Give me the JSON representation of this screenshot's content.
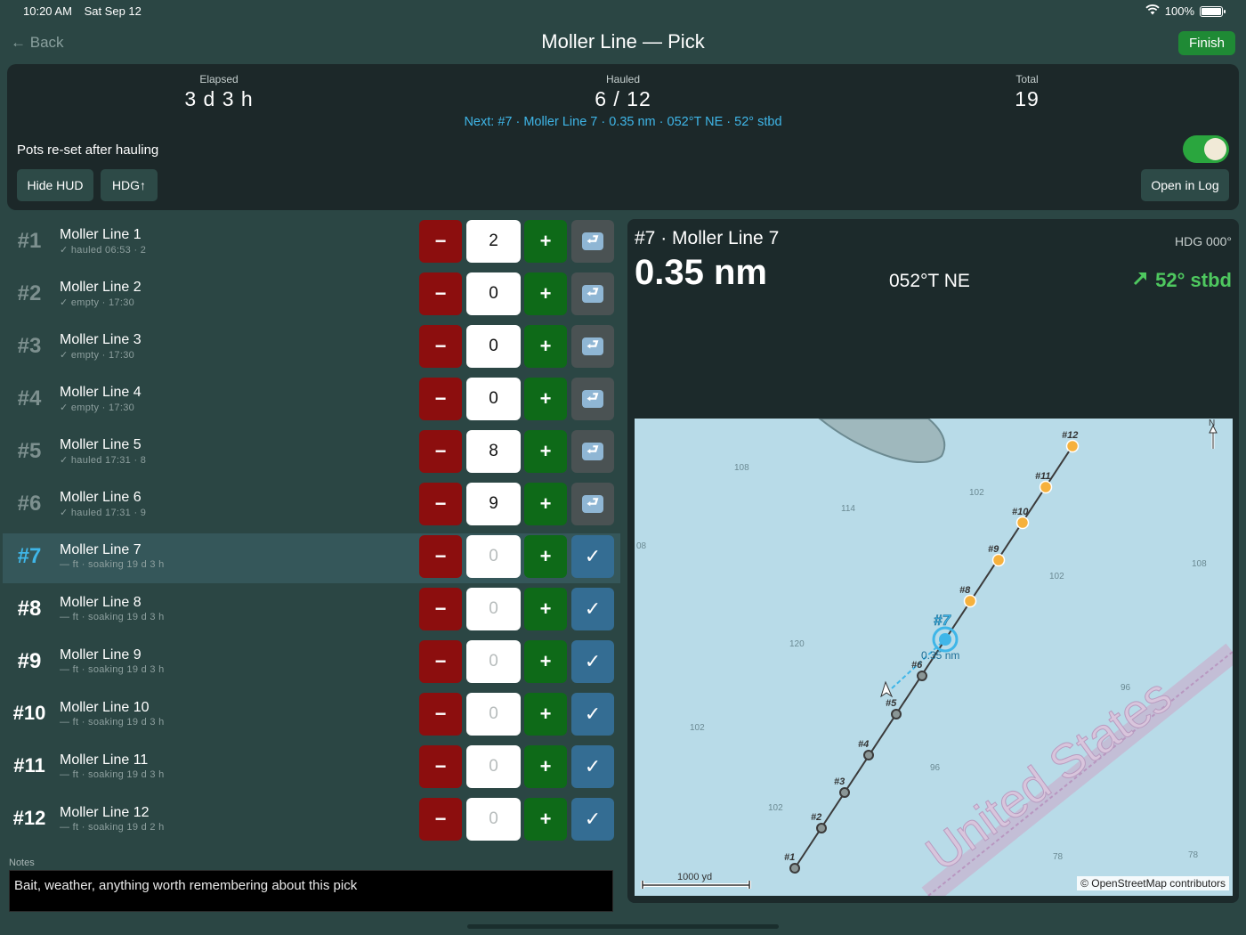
{
  "status": {
    "time": "10:20 AM",
    "date": "Sat Sep 12",
    "battery": "100%",
    "battery_level": 1.0,
    "wifi_icon": "wifi-icon"
  },
  "nav": {
    "back_label": "Back",
    "title": "Moller Line — Pick",
    "finish_label": "Finish"
  },
  "hud": {
    "elapsed_label": "Elapsed",
    "elapsed_value": "3 d 3 h",
    "hauled_label": "Hauled",
    "hauled_value": "6 / 12",
    "total_label": "Total",
    "total_value": "19",
    "next_line": "Next: #7 · Moller Line 7 · 0.35 nm · 052°T NE · 52° stbd",
    "reset_label": "Pots re-set after hauling",
    "reset_toggle_on": true,
    "hide_hud_label": "Hide HUD",
    "hdg_label": "HDG↑",
    "open_log_label": "Open in Log"
  },
  "pots": [
    {
      "num": "#1",
      "name": "Moller Line 1",
      "sub": "✓ hauled 06:53 · 2",
      "count": "2",
      "placeholder": "",
      "state": "hauled"
    },
    {
      "num": "#2",
      "name": "Moller Line 2",
      "sub": "✓ empty · 17:30",
      "count": "0",
      "placeholder": "",
      "state": "hauled"
    },
    {
      "num": "#3",
      "name": "Moller Line 3",
      "sub": "✓ empty · 17:30",
      "count": "0",
      "placeholder": "",
      "state": "hauled"
    },
    {
      "num": "#4",
      "name": "Moller Line 4",
      "sub": "✓ empty · 17:30",
      "count": "0",
      "placeholder": "",
      "state": "hauled"
    },
    {
      "num": "#5",
      "name": "Moller Line 5",
      "sub": "✓ hauled 17:31 · 8",
      "count": "8",
      "placeholder": "",
      "state": "hauled"
    },
    {
      "num": "#6",
      "name": "Moller Line 6",
      "sub": "✓ hauled 17:31 · 9",
      "count": "9",
      "placeholder": "",
      "state": "hauled"
    },
    {
      "num": "#7",
      "name": "Moller Line 7",
      "sub": "— ft · soaking 19 d 3 h",
      "count": "",
      "placeholder": "0",
      "state": "current"
    },
    {
      "num": "#8",
      "name": "Moller Line 8",
      "sub": "— ft · soaking 19 d 3 h",
      "count": "",
      "placeholder": "0",
      "state": "pending"
    },
    {
      "num": "#9",
      "name": "Moller Line 9",
      "sub": "— ft · soaking 19 d 3 h",
      "count": "",
      "placeholder": "0",
      "state": "pending"
    },
    {
      "num": "#10",
      "name": "Moller Line 10",
      "sub": "— ft · soaking 19 d 3 h",
      "count": "",
      "placeholder": "0",
      "state": "pending"
    },
    {
      "num": "#11",
      "name": "Moller Line 11",
      "sub": "— ft · soaking 19 d 3 h",
      "count": "",
      "placeholder": "0",
      "state": "pending"
    },
    {
      "num": "#12",
      "name": "Moller Line 12",
      "sub": "— ft · soaking 19 d 2 h",
      "count": "",
      "placeholder": "0",
      "state": "pending"
    }
  ],
  "notes": {
    "label": "Notes",
    "placeholder": "Bait, weather, anything worth remembering about this pick"
  },
  "navpanel": {
    "target": "#7 · Moller Line 7",
    "heading": "HDG 000°",
    "distance": "0.35 nm",
    "bearing": "052°T NE",
    "turn": "52° stbd",
    "turn_color": "#4ec85f"
  },
  "map": {
    "attribution": "© OpenStreetMap contributors",
    "scale_label": "1000 yd",
    "north_label": "N",
    "country_label": "United States",
    "distance_label": "0.35 nm",
    "active_label": "#7",
    "depths": [
      "108",
      "102",
      "114",
      "108",
      "102",
      "120",
      "96",
      "102",
      "96",
      "102",
      "78",
      "78",
      "08"
    ],
    "pot_labels": [
      "#1",
      "#2",
      "#3",
      "#4",
      "#5",
      "#6",
      "#8",
      "#9",
      "#10",
      "#11",
      "#12"
    ],
    "colors": {
      "water": "#b8dbe8",
      "hauled_pot": "#6e7a7a",
      "pending_pot": "#f6b13c",
      "active": "#3fb6e8"
    }
  }
}
